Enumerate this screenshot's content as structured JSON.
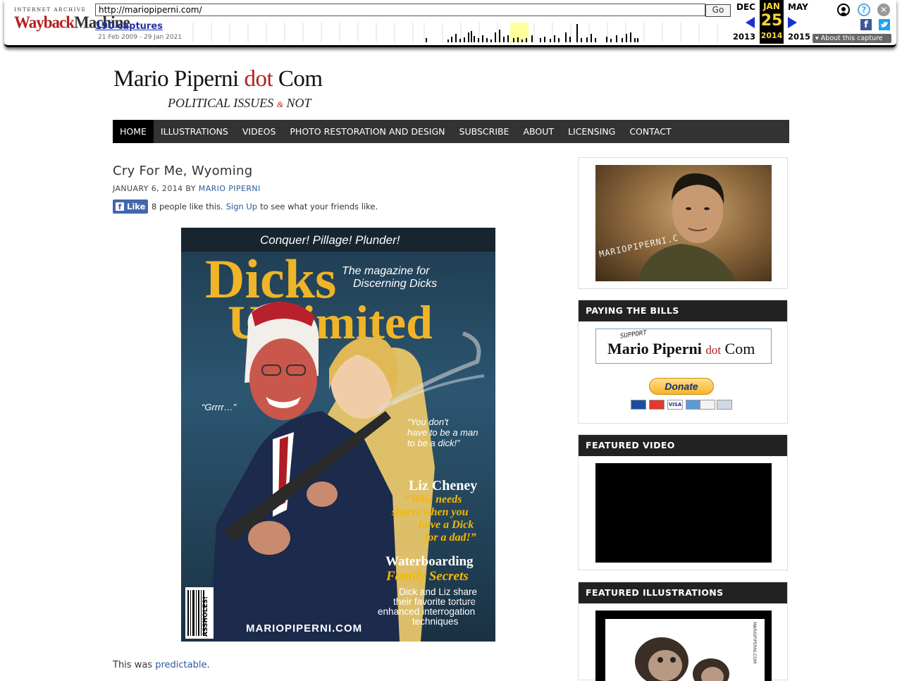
{
  "wayback": {
    "logo_top": "INTERNET ARCHIVE",
    "logo_brand_a": "Wayback",
    "logo_brand_b": "Machine",
    "url": "http://mariopiperni.com/",
    "go_label": "Go",
    "captures": "190 captures",
    "range": "21 Feb 2009 - 29 Jan 2021",
    "prev_month": "DEC",
    "prev_year": "2013",
    "cur_month": "JAN",
    "cur_day": "25",
    "cur_year": "2014",
    "next_month": "MAY",
    "next_year": "2015",
    "about_capture": "About this capture"
  },
  "site": {
    "title_a": "Mario Piperni ",
    "title_dot": "dot",
    "title_b": " Com",
    "tagline_a": "POLITICAL ISSUES ",
    "tagline_amp": "&",
    "tagline_b": " NOT"
  },
  "nav": [
    "HOME",
    "ILLUSTRATIONS",
    "VIDEOS",
    "PHOTO RESTORATION AND DESIGN",
    "SUBSCRIBE",
    "ABOUT",
    "LICENSING",
    "CONTACT"
  ],
  "post": {
    "title": "Cry For Me, Wyoming",
    "date": "JANUARY 6, 2014",
    "by": " BY ",
    "author": "MARIO PIPERNI",
    "fb_like": "Like",
    "fb_text_a": "8 people like this.",
    "fb_signup": "Sign Up",
    "fb_text_b": "to see what your friends like.",
    "body_a": "This was ",
    "body_link": "predictable",
    "body_b": "."
  },
  "cover": {
    "top": "Conquer!   Pillage!   Plunder!",
    "mast_a": "Dicks",
    "mast_b": "Unlimited",
    "sub1": "The magazine for",
    "sub2": "Discerning Dicks",
    "grrr": "“Grrrr…”",
    "quote1": "“You don't",
    "quote2": "have to be a man",
    "quote3": "to be a dick!”",
    "liz": "Liz Cheney",
    "liz1": "“Who needs",
    "liz2": "sisters when you",
    "liz3": "have a Dick",
    "liz4": "for a dad!”",
    "wb1": "Waterboarding",
    "wb2": "Family Secrets",
    "wb3": "Dick and Liz share",
    "wb4": "their favorite ",
    "wb4s": "torture",
    "wb5": "enhanced interrogation",
    "wb6": "techniques",
    "site": "MARIOPIPERNI.COM",
    "barcode": "ASSHOLES!"
  },
  "sidebar": {
    "portrait_watermark": "MARIOPIPERNI.C",
    "paying_title": "PAYING THE BILLS",
    "support_small": "SUPPORT",
    "support_a": "Mario Piperni ",
    "support_dot": "dot",
    "support_b": " Com",
    "donate": "Donate",
    "cards": [
      "Maestro",
      "MasterCard",
      "VISA",
      "AmEx",
      "DISCOVER",
      "BANK"
    ],
    "video_title": "FEATURED VIDEO",
    "ill_title": "FEATURED ILLUSTRATIONS",
    "ill_watermark": "MARIOPIPERNI.COM"
  },
  "colors": {
    "nav_bg": "#333333",
    "accent_red": "#b31f1f",
    "link_blue": "#2a5b9b",
    "wayback_yellow": "#ffd53b"
  }
}
